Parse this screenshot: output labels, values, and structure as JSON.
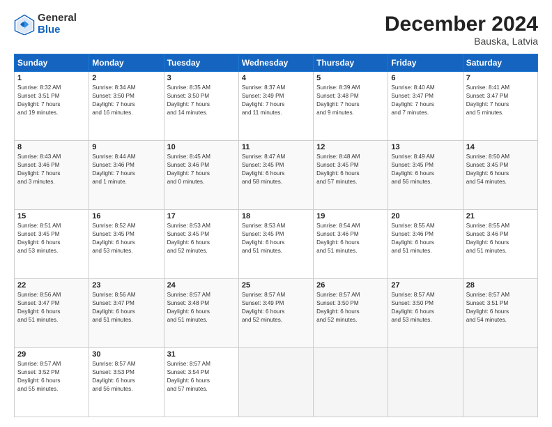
{
  "header": {
    "logo_line1": "General",
    "logo_line2": "Blue",
    "title": "December 2024",
    "subtitle": "Bauska, Latvia"
  },
  "weekdays": [
    "Sunday",
    "Monday",
    "Tuesday",
    "Wednesday",
    "Thursday",
    "Friday",
    "Saturday"
  ],
  "weeks": [
    [
      {
        "day": "1",
        "info": "Sunrise: 8:32 AM\nSunset: 3:51 PM\nDaylight: 7 hours\nand 19 minutes."
      },
      {
        "day": "2",
        "info": "Sunrise: 8:34 AM\nSunset: 3:50 PM\nDaylight: 7 hours\nand 16 minutes."
      },
      {
        "day": "3",
        "info": "Sunrise: 8:35 AM\nSunset: 3:50 PM\nDaylight: 7 hours\nand 14 minutes."
      },
      {
        "day": "4",
        "info": "Sunrise: 8:37 AM\nSunset: 3:49 PM\nDaylight: 7 hours\nand 11 minutes."
      },
      {
        "day": "5",
        "info": "Sunrise: 8:39 AM\nSunset: 3:48 PM\nDaylight: 7 hours\nand 9 minutes."
      },
      {
        "day": "6",
        "info": "Sunrise: 8:40 AM\nSunset: 3:47 PM\nDaylight: 7 hours\nand 7 minutes."
      },
      {
        "day": "7",
        "info": "Sunrise: 8:41 AM\nSunset: 3:47 PM\nDaylight: 7 hours\nand 5 minutes."
      }
    ],
    [
      {
        "day": "8",
        "info": "Sunrise: 8:43 AM\nSunset: 3:46 PM\nDaylight: 7 hours\nand 3 minutes."
      },
      {
        "day": "9",
        "info": "Sunrise: 8:44 AM\nSunset: 3:46 PM\nDaylight: 7 hours\nand 1 minute."
      },
      {
        "day": "10",
        "info": "Sunrise: 8:45 AM\nSunset: 3:46 PM\nDaylight: 7 hours\nand 0 minutes."
      },
      {
        "day": "11",
        "info": "Sunrise: 8:47 AM\nSunset: 3:45 PM\nDaylight: 6 hours\nand 58 minutes."
      },
      {
        "day": "12",
        "info": "Sunrise: 8:48 AM\nSunset: 3:45 PM\nDaylight: 6 hours\nand 57 minutes."
      },
      {
        "day": "13",
        "info": "Sunrise: 8:49 AM\nSunset: 3:45 PM\nDaylight: 6 hours\nand 56 minutes."
      },
      {
        "day": "14",
        "info": "Sunrise: 8:50 AM\nSunset: 3:45 PM\nDaylight: 6 hours\nand 54 minutes."
      }
    ],
    [
      {
        "day": "15",
        "info": "Sunrise: 8:51 AM\nSunset: 3:45 PM\nDaylight: 6 hours\nand 53 minutes."
      },
      {
        "day": "16",
        "info": "Sunrise: 8:52 AM\nSunset: 3:45 PM\nDaylight: 6 hours\nand 53 minutes."
      },
      {
        "day": "17",
        "info": "Sunrise: 8:53 AM\nSunset: 3:45 PM\nDaylight: 6 hours\nand 52 minutes."
      },
      {
        "day": "18",
        "info": "Sunrise: 8:53 AM\nSunset: 3:45 PM\nDaylight: 6 hours\nand 51 minutes."
      },
      {
        "day": "19",
        "info": "Sunrise: 8:54 AM\nSunset: 3:46 PM\nDaylight: 6 hours\nand 51 minutes."
      },
      {
        "day": "20",
        "info": "Sunrise: 8:55 AM\nSunset: 3:46 PM\nDaylight: 6 hours\nand 51 minutes."
      },
      {
        "day": "21",
        "info": "Sunrise: 8:55 AM\nSunset: 3:46 PM\nDaylight: 6 hours\nand 51 minutes."
      }
    ],
    [
      {
        "day": "22",
        "info": "Sunrise: 8:56 AM\nSunset: 3:47 PM\nDaylight: 6 hours\nand 51 minutes."
      },
      {
        "day": "23",
        "info": "Sunrise: 8:56 AM\nSunset: 3:47 PM\nDaylight: 6 hours\nand 51 minutes."
      },
      {
        "day": "24",
        "info": "Sunrise: 8:57 AM\nSunset: 3:48 PM\nDaylight: 6 hours\nand 51 minutes."
      },
      {
        "day": "25",
        "info": "Sunrise: 8:57 AM\nSunset: 3:49 PM\nDaylight: 6 hours\nand 52 minutes."
      },
      {
        "day": "26",
        "info": "Sunrise: 8:57 AM\nSunset: 3:50 PM\nDaylight: 6 hours\nand 52 minutes."
      },
      {
        "day": "27",
        "info": "Sunrise: 8:57 AM\nSunset: 3:50 PM\nDaylight: 6 hours\nand 53 minutes."
      },
      {
        "day": "28",
        "info": "Sunrise: 8:57 AM\nSunset: 3:51 PM\nDaylight: 6 hours\nand 54 minutes."
      }
    ],
    [
      {
        "day": "29",
        "info": "Sunrise: 8:57 AM\nSunset: 3:52 PM\nDaylight: 6 hours\nand 55 minutes."
      },
      {
        "day": "30",
        "info": "Sunrise: 8:57 AM\nSunset: 3:53 PM\nDaylight: 6 hours\nand 56 minutes."
      },
      {
        "day": "31",
        "info": "Sunrise: 8:57 AM\nSunset: 3:54 PM\nDaylight: 6 hours\nand 57 minutes."
      },
      null,
      null,
      null,
      null
    ]
  ]
}
